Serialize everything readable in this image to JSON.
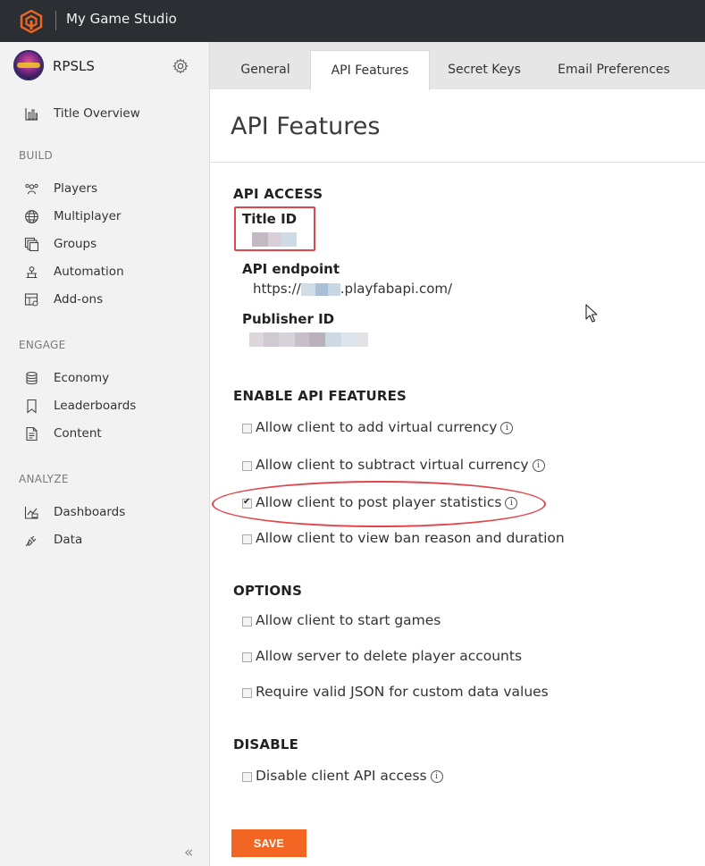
{
  "header": {
    "studio_name": "My Game Studio"
  },
  "sidebar": {
    "title_name": "RPSLS",
    "overview_label": "Title Overview",
    "sections": {
      "build": "BUILD",
      "engage": "ENGAGE",
      "analyze": "ANALYZE"
    },
    "build_items": [
      "Players",
      "Multiplayer",
      "Groups",
      "Automation",
      "Add-ons"
    ],
    "engage_items": [
      "Economy",
      "Leaderboards",
      "Content"
    ],
    "analyze_items": [
      "Dashboards",
      "Data"
    ],
    "collapse_glyph": "«"
  },
  "tabs": [
    "General",
    "API Features",
    "Secret Keys",
    "Email Preferences"
  ],
  "active_tab": "API Features",
  "page": {
    "title": "API Features",
    "api_access": {
      "heading": "API ACCESS",
      "title_id_label": "Title ID",
      "endpoint_label": "API endpoint",
      "endpoint_prefix": "https://",
      "endpoint_suffix": ".playfabapi.com/",
      "publisher_id_label": "Publisher ID"
    },
    "enable_api_features": {
      "heading": "ENABLE API FEATURES",
      "options": [
        {
          "label": "Allow client to add virtual currency",
          "checked": false,
          "info": true
        },
        {
          "label": "Allow client to subtract virtual currency",
          "checked": false,
          "info": true
        },
        {
          "label": "Allow client to post player statistics",
          "checked": true,
          "info": true
        },
        {
          "label": "Allow client to view ban reason and duration",
          "checked": false,
          "info": false
        }
      ]
    },
    "options": {
      "heading": "OPTIONS",
      "items": [
        {
          "label": "Allow client to start games",
          "checked": false
        },
        {
          "label": "Allow server to delete player accounts",
          "checked": false
        },
        {
          "label": "Require valid JSON for custom data values",
          "checked": false
        }
      ]
    },
    "disable": {
      "heading": "DISABLE",
      "items": [
        {
          "label": "Disable client API access",
          "checked": false,
          "info": true
        }
      ]
    },
    "save_label": "SAVE",
    "info_glyph": "i"
  },
  "colors": {
    "topbar": "#2b2f33",
    "accent": "#f26522",
    "annotation": "#e0474c"
  }
}
